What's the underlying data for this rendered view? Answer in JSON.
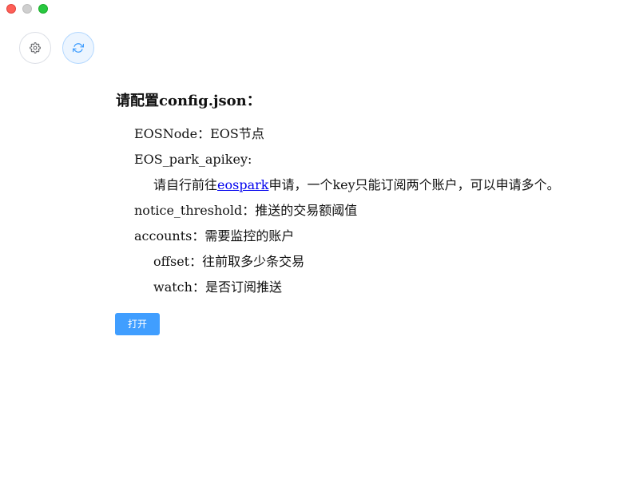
{
  "window": {
    "controls": [
      "close",
      "minimize",
      "maximize"
    ]
  },
  "toolbar": {
    "settings_icon": "gear-icon",
    "refresh_icon": "refresh-icon"
  },
  "config": {
    "heading": "请配置config.json：",
    "eos_node_key": "EOSNode：",
    "eos_node_desc": "EOS节点",
    "apikey_key": "EOS_park_apikey:",
    "apikey_desc_prefix": "请自行前往",
    "apikey_link": "eospark",
    "apikey_desc_suffix": "申请，一个key只能订阅两个账户，可以申请多个。",
    "threshold_key": "notice_threshold：",
    "threshold_desc": "推送的交易额阈值",
    "accounts_key": "accounts：",
    "accounts_desc": "需要监控的账户",
    "offset_key": "offset：",
    "offset_desc": "往前取多少条交易",
    "watch_key": "watch：",
    "watch_desc": "是否订阅推送"
  },
  "actions": {
    "open_label": "打开"
  },
  "colors": {
    "primary": "#409eff",
    "link": "#0000ee"
  }
}
